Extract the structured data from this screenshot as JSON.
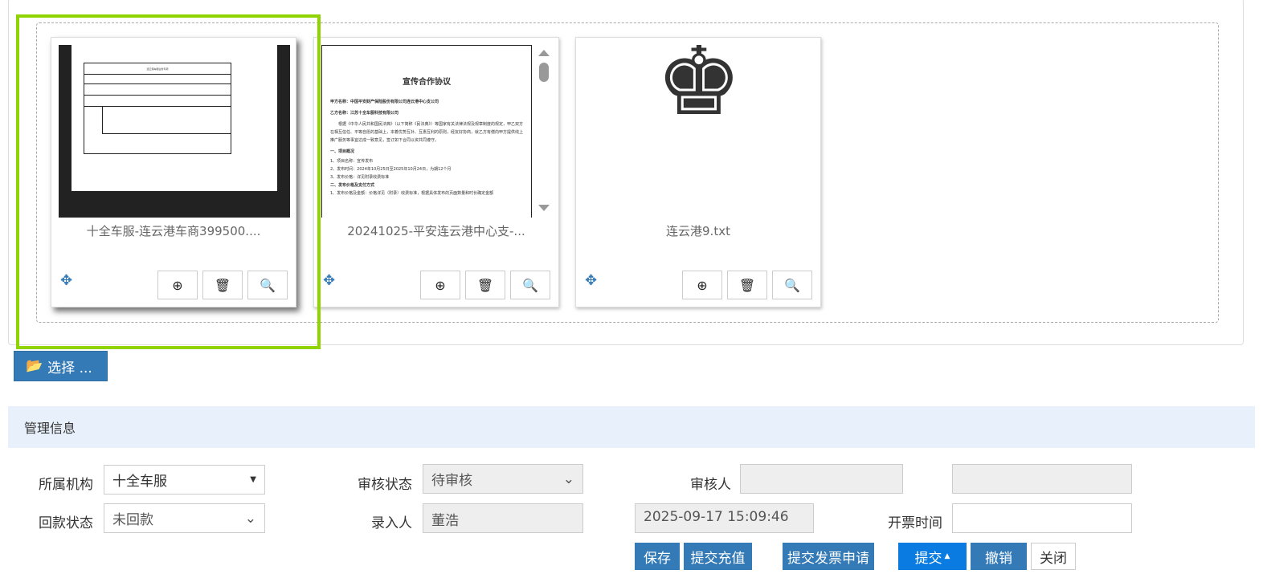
{
  "files": [
    {
      "caption": "十全车服-连云港车商399500....",
      "preview_title": "连云港车服业务专项"
    },
    {
      "caption": "20241025-平安连云港中心支-...",
      "preview": {
        "title": "宣传合作协议",
        "lines": [
          "甲方名称：中国平安财产保险股份有限公司连云港中心支公司",
          "乙方名称：江苏十全车服科技有限公司",
          "根据《中华人民共和国民法典》（以下简称《民法典》）等国家有关法律法规及规章制度的规定，甲乙双方在相互信任、平等自愿的基础上，本着优势互补、互惠互利的原则，经友好协商，就乙方有偿向甲方提供线上推广服务等事宜达成一致意见，签订如下合同以资共同遵守。",
          "一、项目概况",
          "1、项目名称：宣传发布",
          "2、发布时间：2024年10月25日至2025年10月24日，为期12个月",
          "3、发布价格：详见附录收费标准",
          "二、发布价格及支付方式",
          "1、发布价格及金额：价格详见（附录）收费标准，根据具体发布的页面数量和时长确定金额"
        ]
      }
    },
    {
      "caption": "连云港9.txt"
    }
  ],
  "choose_label": "选择 ...",
  "section_title": "管理信息",
  "form": {
    "org_label": "所属机构",
    "org_value": "十全车服",
    "audit_status_label": "审核状态",
    "audit_status_value": "待审核",
    "auditor_label": "审核人",
    "auditor_value": "",
    "extra_value": "",
    "payment_label": "回款状态",
    "payment_value": "未回款",
    "entered_by_label": "录入人",
    "entered_by_value": "董浩",
    "entry_time_value": "2025-09-17 15:09:46",
    "invoice_time_label": "开票时间",
    "invoice_time_value": ""
  },
  "actions": {
    "save": "保存",
    "submit_recharge": "提交充值",
    "submit_invoice": "提交发票申请",
    "submit": "提交",
    "revoke": "撤销",
    "close": "关闭"
  },
  "colors": {
    "primary": "#337ab7",
    "submit": "#0a7be0",
    "highlight": "#8fd400"
  }
}
